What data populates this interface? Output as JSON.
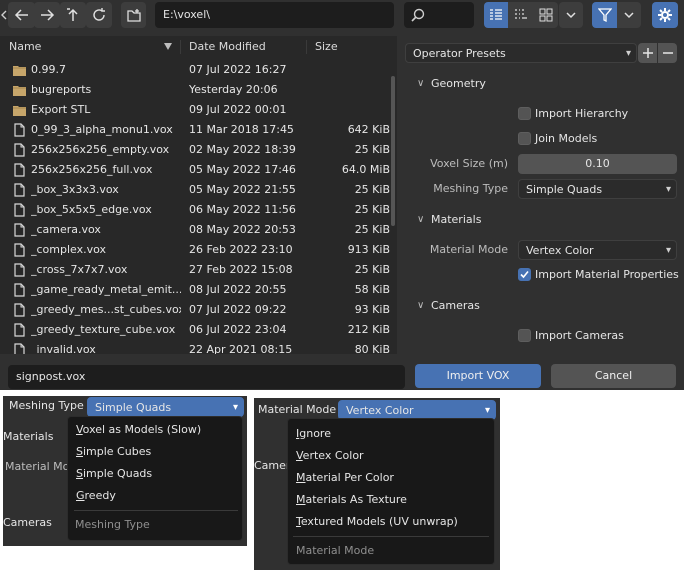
{
  "toolbar": {
    "path": "E:\\voxel\\",
    "search_placeholder": "",
    "icons": [
      "left-arrow-icon",
      "back-arrow-icon",
      "forward-arrow-icon",
      "parent-dir-icon",
      "refresh-icon",
      "new-folder-icon",
      "vertical-list-icon",
      "horizontal-list-icon",
      "thumbnails-icon",
      "chevron-down-icon",
      "filter-icon",
      "chevron-down-icon",
      "gear-icon"
    ]
  },
  "file_list": {
    "headers": {
      "name": "Name",
      "date": "Date Modified",
      "size": "Size"
    },
    "rows": [
      {
        "type": "folder",
        "name": "0.99.7",
        "date": "07 Jul 2022 16:27",
        "size": ""
      },
      {
        "type": "folder",
        "name": "bugreports",
        "date": "Yesterday 20:06",
        "size": ""
      },
      {
        "type": "folder",
        "name": "Export STL",
        "date": "09 Jul 2022 00:01",
        "size": ""
      },
      {
        "type": "file",
        "name": "0_99_3_alpha_monu1.vox",
        "date": "11 Mar 2018 17:45",
        "size": "642 KiB"
      },
      {
        "type": "file",
        "name": "256x256x256_empty.vox",
        "date": "02 May 2022 18:39",
        "size": "25 KiB"
      },
      {
        "type": "file",
        "name": "256x256x256_full.vox",
        "date": "05 May 2022 17:46",
        "size": "64.0 MiB"
      },
      {
        "type": "file",
        "name": "_box_3x3x3.vox",
        "date": "05 May 2022 21:55",
        "size": "25 KiB"
      },
      {
        "type": "file",
        "name": "_box_5x5x5_edge.vox",
        "date": "06 May 2022 11:56",
        "size": "25 KiB"
      },
      {
        "type": "file",
        "name": "_camera.vox",
        "date": "08 May 2022 20:53",
        "size": "25 KiB"
      },
      {
        "type": "file",
        "name": "_complex.vox",
        "date": "26 Feb 2022 23:10",
        "size": "913 KiB"
      },
      {
        "type": "file",
        "name": "_cross_7x7x7.vox",
        "date": "27 Feb 2022 15:08",
        "size": "25 KiB"
      },
      {
        "type": "file",
        "name": "_game_ready_metal_emit....",
        "date": "08 Jul 2022 20:55",
        "size": "58 KiB"
      },
      {
        "type": "file",
        "name": "_greedy_mes...st_cubes.vox",
        "date": "07 Jul 2022 09:22",
        "size": "93 KiB"
      },
      {
        "type": "file",
        "name": "_greedy_texture_cube.vox",
        "date": "06 Jul 2022 23:04",
        "size": "212 KiB"
      },
      {
        "type": "file",
        "name": "_invalid.vox",
        "date": "22 Apr 2021 08:15",
        "size": "80 KiB"
      }
    ]
  },
  "panel": {
    "operator_presets": "Operator Presets",
    "geometry": {
      "title": "Geometry",
      "import_hierarchy": {
        "label": "Import Hierarchy",
        "checked": false
      },
      "join_models": {
        "label": "Join Models",
        "checked": false
      },
      "voxel_size_label": "Voxel Size (m)",
      "voxel_size_value": "0.10",
      "meshing_type_label": "Meshing Type",
      "meshing_type_value": "Simple Quads"
    },
    "materials": {
      "title": "Materials",
      "material_mode_label": "Material Mode",
      "material_mode_value": "Vertex Color",
      "import_material_properties": {
        "label": "Import Material Properties",
        "checked": true
      }
    },
    "cameras": {
      "title": "Cameras",
      "import_cameras": {
        "label": "Import Cameras",
        "checked": false
      }
    }
  },
  "footer": {
    "filename": "signpost.vox",
    "import_label": "Import VOX",
    "cancel_label": "Cancel"
  },
  "popup_meshing": {
    "label": "Meshing Type",
    "value": "Simple Quads",
    "bg_labels": {
      "materials": "Materials",
      "material_mode": "Material Mod",
      "cameras": "Cameras"
    },
    "items": [
      {
        "key": "V",
        "rest": "oxel as Models (Slow)"
      },
      {
        "key": "S",
        "rest": "imple Cubes"
      },
      {
        "key": "S",
        "rest": "imple Quads"
      },
      {
        "key": "G",
        "rest": "reedy"
      }
    ],
    "hint": "Meshing Type"
  },
  "popup_material": {
    "label": "Material Mode",
    "value": "Vertex Color",
    "bg_label": "Camer",
    "items": [
      {
        "key": "I",
        "rest": "gnore"
      },
      {
        "key": "V",
        "rest": "ertex Color"
      },
      {
        "key": "M",
        "rest": "aterial Per Color"
      },
      {
        "key": "M",
        "rest": "aterials As Texture"
      },
      {
        "key": "T",
        "rest": "extured Models (UV unwrap)"
      }
    ],
    "hint": "Material Mode"
  },
  "colors": {
    "accent": "#4772b3",
    "panel": "#303030",
    "list": "#282828",
    "field": "#1d1d1d"
  }
}
